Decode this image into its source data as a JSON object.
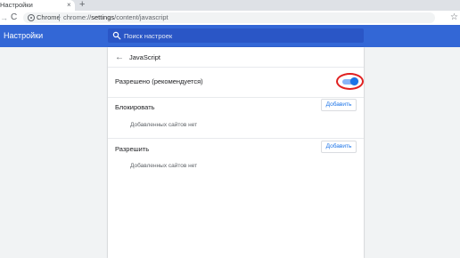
{
  "browser": {
    "tab_title": "Настройки",
    "tab_close": "×",
    "new_tab": "+",
    "forward": "→",
    "reload": "C",
    "site_label": "Chrome",
    "url_scheme": "chrome://",
    "url_host": "settings",
    "url_path": "/content/javascript",
    "bookmark": "☆"
  },
  "header": {
    "title": "Настройки",
    "search_placeholder": "Поиск настроек"
  },
  "page": {
    "back": "←",
    "title": "JavaScript",
    "allowed_label": "Разрешено (рекомендуется)",
    "allowed_enabled": true,
    "block": {
      "label": "Блокировать",
      "add_label": "Добавить",
      "empty": "Добавленных сайтов нет"
    },
    "allow": {
      "label": "Разрешить",
      "add_label": "Добавить",
      "empty": "Добавленных сайтов нет"
    }
  },
  "colors": {
    "header": "#3367d6",
    "accent": "#1a73e8",
    "highlight": "#e02020"
  }
}
